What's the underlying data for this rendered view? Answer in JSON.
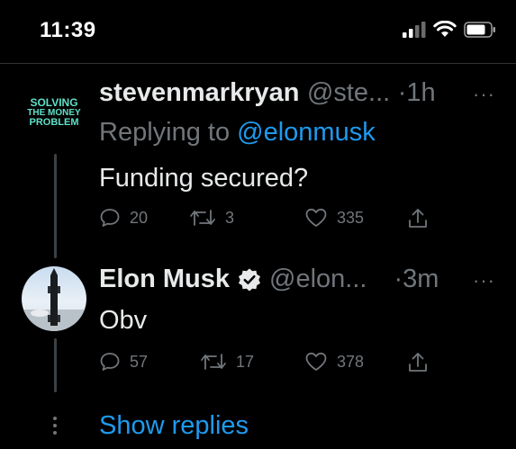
{
  "status_bar": {
    "time": "11:39"
  },
  "tweets": [
    {
      "display_name": "stevenmarkryan",
      "handle": "@ste...",
      "time": "·1h",
      "replying_prefix": "Replying to ",
      "replying_to": "@elonmusk",
      "text": "Funding secured?",
      "avatar_text": [
        "SOLVING",
        "THE MONEY",
        "PROBLEM"
      ],
      "stats": {
        "replies": "20",
        "retweets": "3",
        "likes": "335"
      }
    },
    {
      "display_name": "Elon Musk",
      "verified": true,
      "handle": "@elon...",
      "time": "·3m",
      "text": "Obv",
      "stats": {
        "replies": "57",
        "retweets": "17",
        "likes": "378"
      }
    }
  ],
  "show_replies_label": "Show replies",
  "colors": {
    "accent": "#1d9bf0",
    "secondary": "#71767b",
    "background": "#000000"
  }
}
